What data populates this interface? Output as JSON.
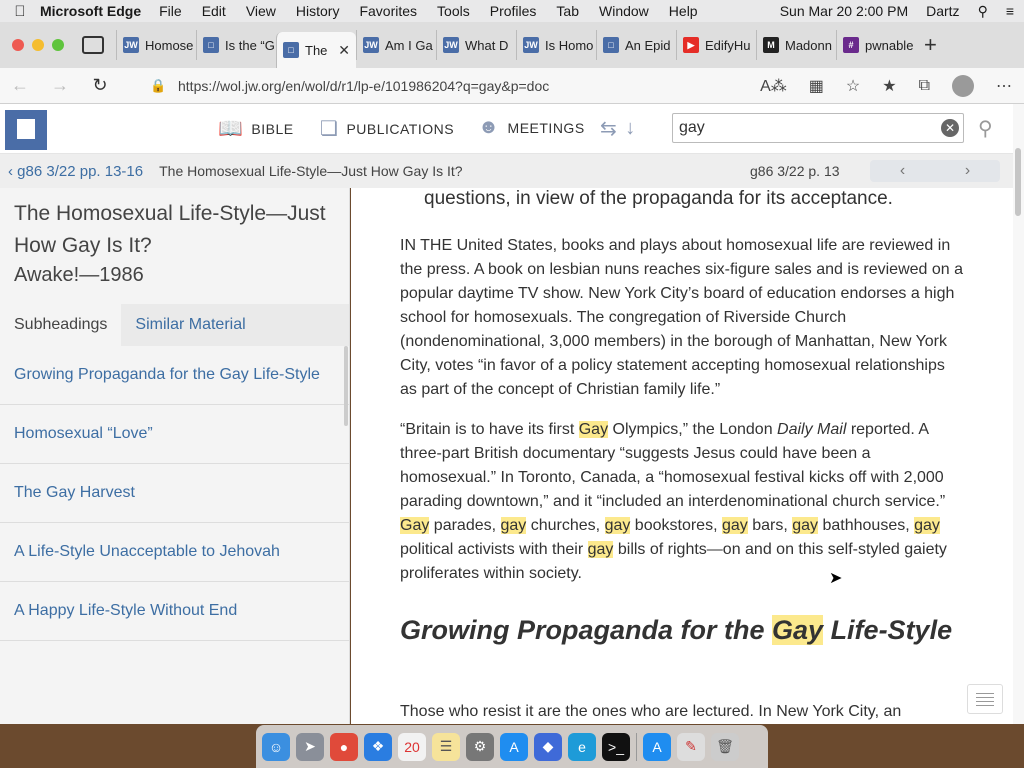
{
  "menubar": {
    "app": "Microsoft Edge",
    "items": [
      "File",
      "Edit",
      "View",
      "History",
      "Favorites",
      "Tools",
      "Profiles",
      "Tab",
      "Window",
      "Help"
    ],
    "clock": "Sun Mar 20  2:00 PM",
    "user": "Dartz"
  },
  "tabs": [
    {
      "label": "Homose",
      "icon": "jw-icon"
    },
    {
      "label": "Is the “G",
      "icon": "wol-icon"
    },
    {
      "label": "The",
      "icon": "wol-icon"
    },
    {
      "label": "Am I Ga",
      "icon": "jw-icon"
    },
    {
      "label": "What D",
      "icon": "jw-icon"
    },
    {
      "label": "Is Homo",
      "icon": "jw-icon"
    },
    {
      "label": "An Epid",
      "icon": "wol-icon"
    },
    {
      "label": "EdifyHu",
      "icon": "youtube-icon"
    },
    {
      "label": "Madonn",
      "icon": "m-icon"
    },
    {
      "label": "pwnable",
      "icon": "hash-icon"
    }
  ],
  "address": {
    "url": "https://wol.jw.org/en/wol/d/r1/lp-e/101986204?q=gay&p=doc"
  },
  "siteheader": {
    "bible": "BIBLE",
    "publications": "PUBLICATIONS",
    "meetings": "MEETINGS",
    "search_value": "gay"
  },
  "subbar": {
    "crumb": "g86 3/22 pp. 13-16",
    "doc_title": "The Homosexual Life-Style—Just How Gay Is It?",
    "page_ref": "g86 3/22 p. 13"
  },
  "sidebar": {
    "title": "The Homosexual Life-Style—Just How Gay Is It?",
    "subtitle": "Awake!—1986",
    "tab_subheadings": "Subheadings",
    "tab_similar": "Similar Material",
    "items": [
      "Growing Propaganda for the Gay Life-Style",
      "Homosexual “Love”",
      "The Gay Harvest",
      "A Life-Style Unacceptable to Jehovah",
      "A Happy Life-Style Without End"
    ]
  },
  "article": {
    "top_line": "questions, in view of the propaganda for its acceptance.",
    "para1": "IN THE United States, books and plays about homosexual life are reviewed in the press. A book on lesbian nuns reaches six-figure sales and is reviewed on a popular daytime TV show. New York City’s board of education endorses a high school for homosexuals. The congregation of Riverside Church (nondenominational, 3,000 members) in the borough of Manhattan, New York City, votes “in favor of a policy statement accepting homosexual relationships as part of the concept of Christian family life.”",
    "para2": {
      "a": "“Britain is to have its first ",
      "hl1": "Gay",
      "b": " Olympics,” the London ",
      "em": "Daily Mail",
      "c": " reported. A three-part British documentary “suggests Jesus could have been a homosexual.” In Toronto, Canada, a “homosexual festival kicks off with 2,000 parading downtown,” and it “included an interdenominational church service.” ",
      "hl2": "Gay",
      "d": " parades, ",
      "hl3": "gay",
      "e": " churches, ",
      "hl4": "gay",
      "f": " bookstores, ",
      "hl5": "gay",
      "g": " bars, ",
      "hl6": "gay",
      "h": " bathhouses, ",
      "hl7": "gay",
      "i": " political activists with their ",
      "hl8": "gay",
      "j": " bills of rights—on and on this self-styled gaiety proliferates within society."
    },
    "heading": {
      "a": "Growing Propaganda for the ",
      "hl": "Gay",
      "b": " Life-Style"
    },
    "para3": "Those who resist it are the ones who are lectured. In New York City, an"
  },
  "colors": {
    "highlight": "#fce98d",
    "link": "#3d6ea3",
    "brand": "#4a6da7"
  }
}
